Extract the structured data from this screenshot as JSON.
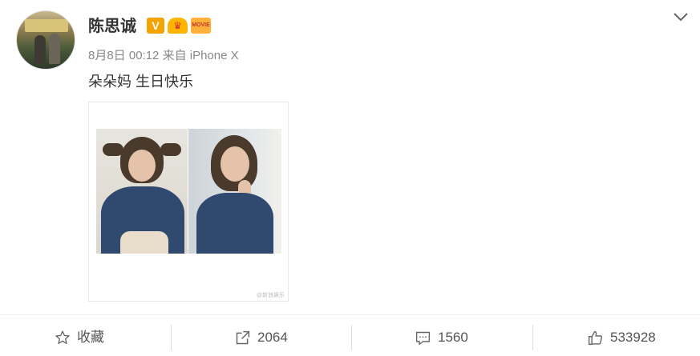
{
  "post": {
    "username": "陈思诚",
    "badges": {
      "verified": "V",
      "crown": "♛",
      "movie": "MOVIE"
    },
    "timestamp": "8月8日 00:12",
    "source": "来自 iPhone X",
    "text": "朵朵妈 生日快乐",
    "watermark": "@新浪娱乐"
  },
  "actions": {
    "favorite_label": "收藏",
    "repost_count": "2064",
    "comment_count": "1560",
    "like_count": "533928"
  },
  "colors": {
    "accent": "#ff8200",
    "text_gray": "#888888",
    "icon_gray": "#666666"
  },
  "icons": {
    "menu": "chevron-down-icon",
    "favorite": "star-icon",
    "repost": "share-icon",
    "comment": "comment-icon",
    "like": "thumbs-up-icon"
  }
}
